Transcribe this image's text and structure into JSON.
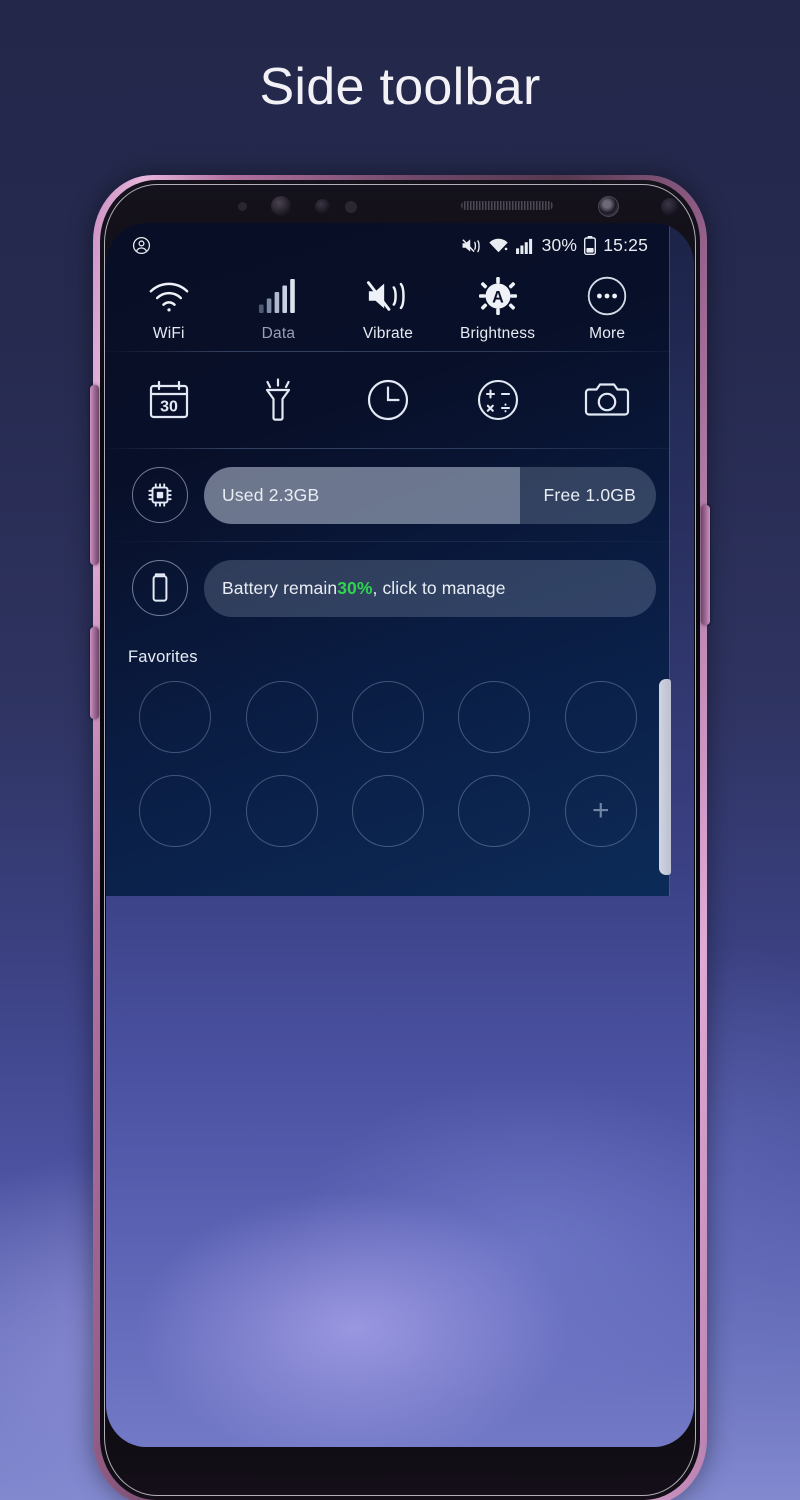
{
  "header": {
    "title": "Side toolbar"
  },
  "statusbar": {
    "account_icon": "account-circle-icon",
    "mute_icon": "volume-mute-vibrate-icon",
    "wifi_icon": "wifi-signal-icon",
    "cellular_icon": "cellular-signal-icon",
    "battery_percent": "30%",
    "battery_icon": "battery-icon",
    "time": "15:25"
  },
  "quick_toggles": {
    "row1": [
      {
        "label": "WiFi",
        "icon": "wifi-icon",
        "dim": false
      },
      {
        "label": "Data",
        "icon": "data-signal-icon",
        "dim": true
      },
      {
        "label": "Vibrate",
        "icon": "vibrate-icon",
        "dim": false
      },
      {
        "label": "Brightness",
        "icon": "brightness-auto-icon",
        "dim": false
      },
      {
        "label": "More",
        "icon": "more-dots-icon",
        "dim": false
      }
    ],
    "row2": [
      {
        "label": "Calendar",
        "icon": "calendar-30-icon",
        "day": "30"
      },
      {
        "label": "Flashlight",
        "icon": "flashlight-icon"
      },
      {
        "label": "Clock",
        "icon": "clock-icon"
      },
      {
        "label": "Calculator",
        "icon": "calculator-icon"
      },
      {
        "label": "Camera",
        "icon": "camera-icon"
      }
    ]
  },
  "memory": {
    "icon": "cpu-chip-icon",
    "used_label": "Used 2.3GB",
    "free_label": "Free 1.0GB",
    "used_percent": 70
  },
  "battery": {
    "icon": "battery-outline-icon",
    "text_before": "Battery remain ",
    "percent": "30%",
    "text_after": ", click to manage",
    "percent_color": "#2fd44f"
  },
  "favorites": {
    "title": "Favorites",
    "slots": [
      "",
      "",
      "",
      "",
      "",
      "",
      "",
      "",
      "",
      "+"
    ],
    "add_label": "+"
  },
  "edge_handle": {
    "name": "side-toolbar-edge-handle"
  },
  "colors": {
    "panel_dark": "#080e24",
    "panel_blue": "#0b2a56",
    "accent_green": "#2fd44f",
    "frame_pink": "#c994c0"
  }
}
